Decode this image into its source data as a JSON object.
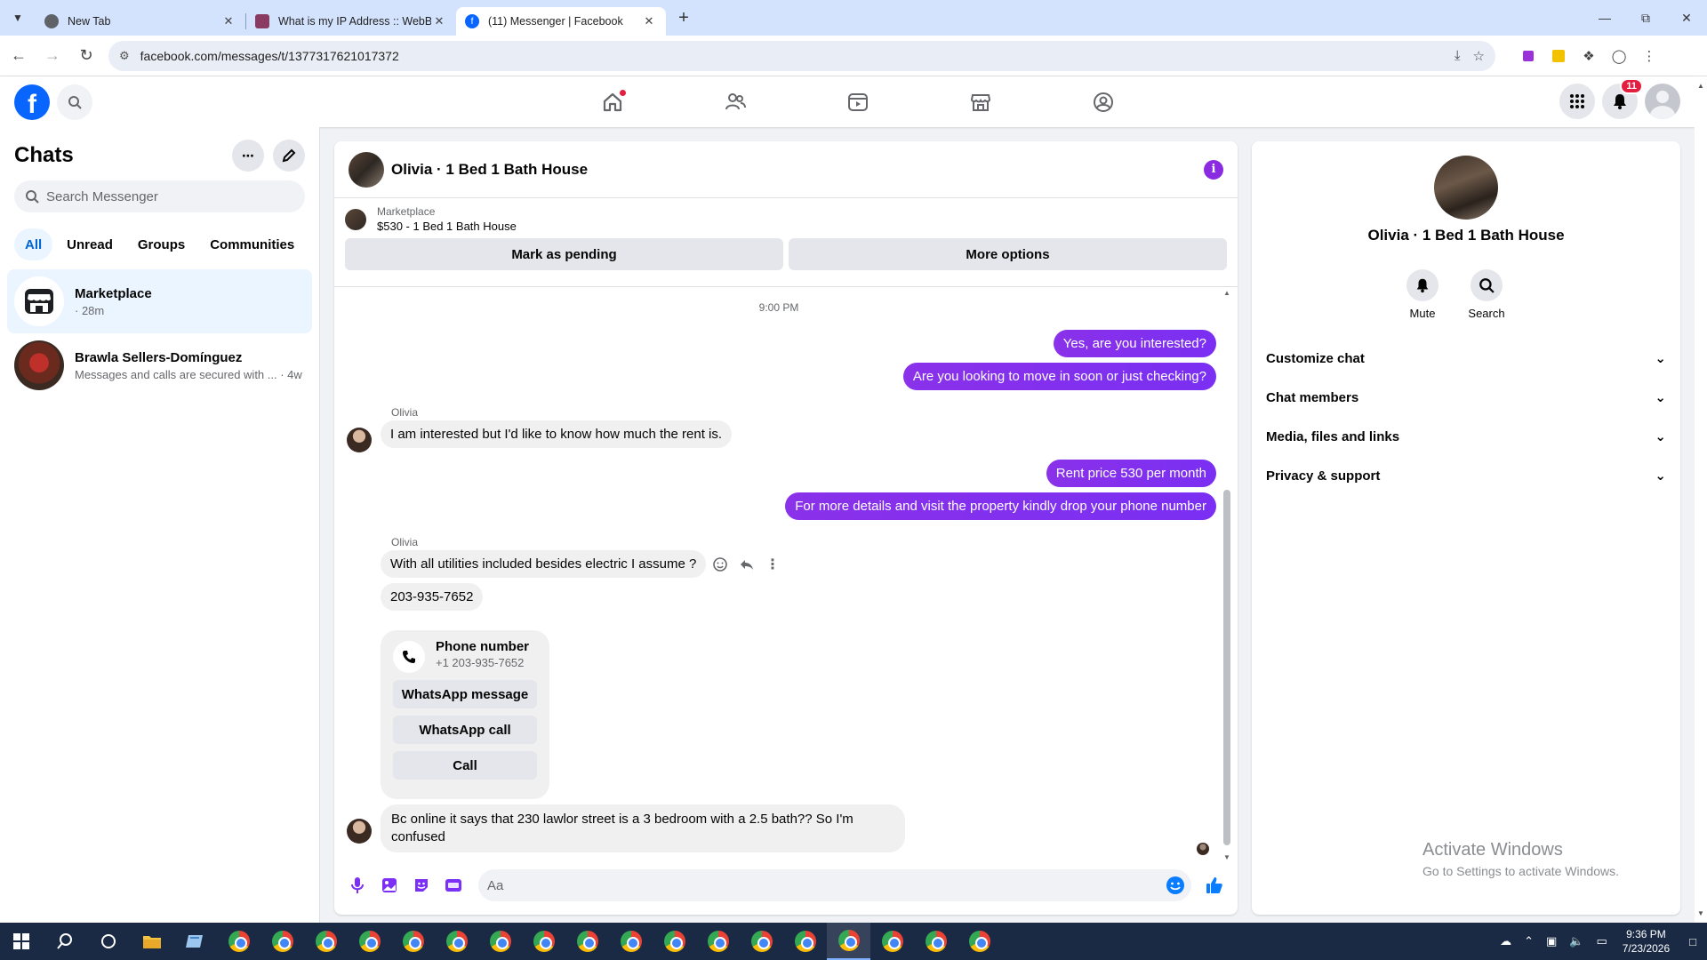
{
  "browser": {
    "tabs": [
      {
        "title": "New Tab",
        "active": false
      },
      {
        "title": "What is my IP Address :: WebBr",
        "active": false
      },
      {
        "title": "(11) Messenger | Facebook",
        "active": true
      }
    ],
    "url": "facebook.com/messages/t/1377317621017372"
  },
  "fb": {
    "notif_count": "11"
  },
  "left": {
    "title": "Chats",
    "search_placeholder": "Search Messenger",
    "filters": [
      "All",
      "Unread",
      "Groups",
      "Communities"
    ],
    "chats": [
      {
        "name": "Marketplace",
        "sub": "· 28m"
      },
      {
        "name": "Brawla Sellers-Domínguez",
        "sub": "Messages and calls are secured with ... · 4w"
      }
    ]
  },
  "conversation": {
    "name": "Olivia · 1 Bed 1 Bath House",
    "marketplace_label": "Marketplace",
    "listing": "$530 - 1 Bed 1 Bath House",
    "mark_pending": "Mark as pending",
    "more_options": "More options",
    "timestamp": "9:00 PM",
    "messages": [
      {
        "from": "me",
        "text": "Yes, are you interested?"
      },
      {
        "from": "me",
        "text": "Are you looking to move in soon or just checking?"
      },
      {
        "from": "them",
        "sender": "Olivia",
        "text": "I am interested but I'd like to know how much the rent is."
      },
      {
        "from": "me",
        "text": "Rent price 530 per month"
      },
      {
        "from": "me",
        "text": "For more details and visit the property kindly drop your phone number"
      },
      {
        "from": "them",
        "sender": "Olivia",
        "text": "With all utilities included besides electric I assume ?"
      },
      {
        "from": "them",
        "text": "203-935-7652"
      },
      {
        "from": "them",
        "text": "Bc online it says that 230 lawlor street is a 3 bedroom with a 2.5 bath?? So I'm confused"
      }
    ],
    "phone_card": {
      "title": "Phone number",
      "number": "+1 203-935-7652",
      "buttons": [
        "WhatsApp message",
        "WhatsApp call",
        "Call"
      ]
    },
    "composer_placeholder": "Aa"
  },
  "details": {
    "name": "Olivia · 1 Bed 1 Bath House",
    "actions": [
      "Mute",
      "Search"
    ],
    "sections": [
      "Customize chat",
      "Chat members",
      "Media, files and links",
      "Privacy & support"
    ]
  },
  "watermark": {
    "line1": "Activate Windows",
    "line2": "Go to Settings to activate Windows."
  },
  "taskbar": {
    "time": "9:36 PM",
    "date": "7/23/2026"
  }
}
